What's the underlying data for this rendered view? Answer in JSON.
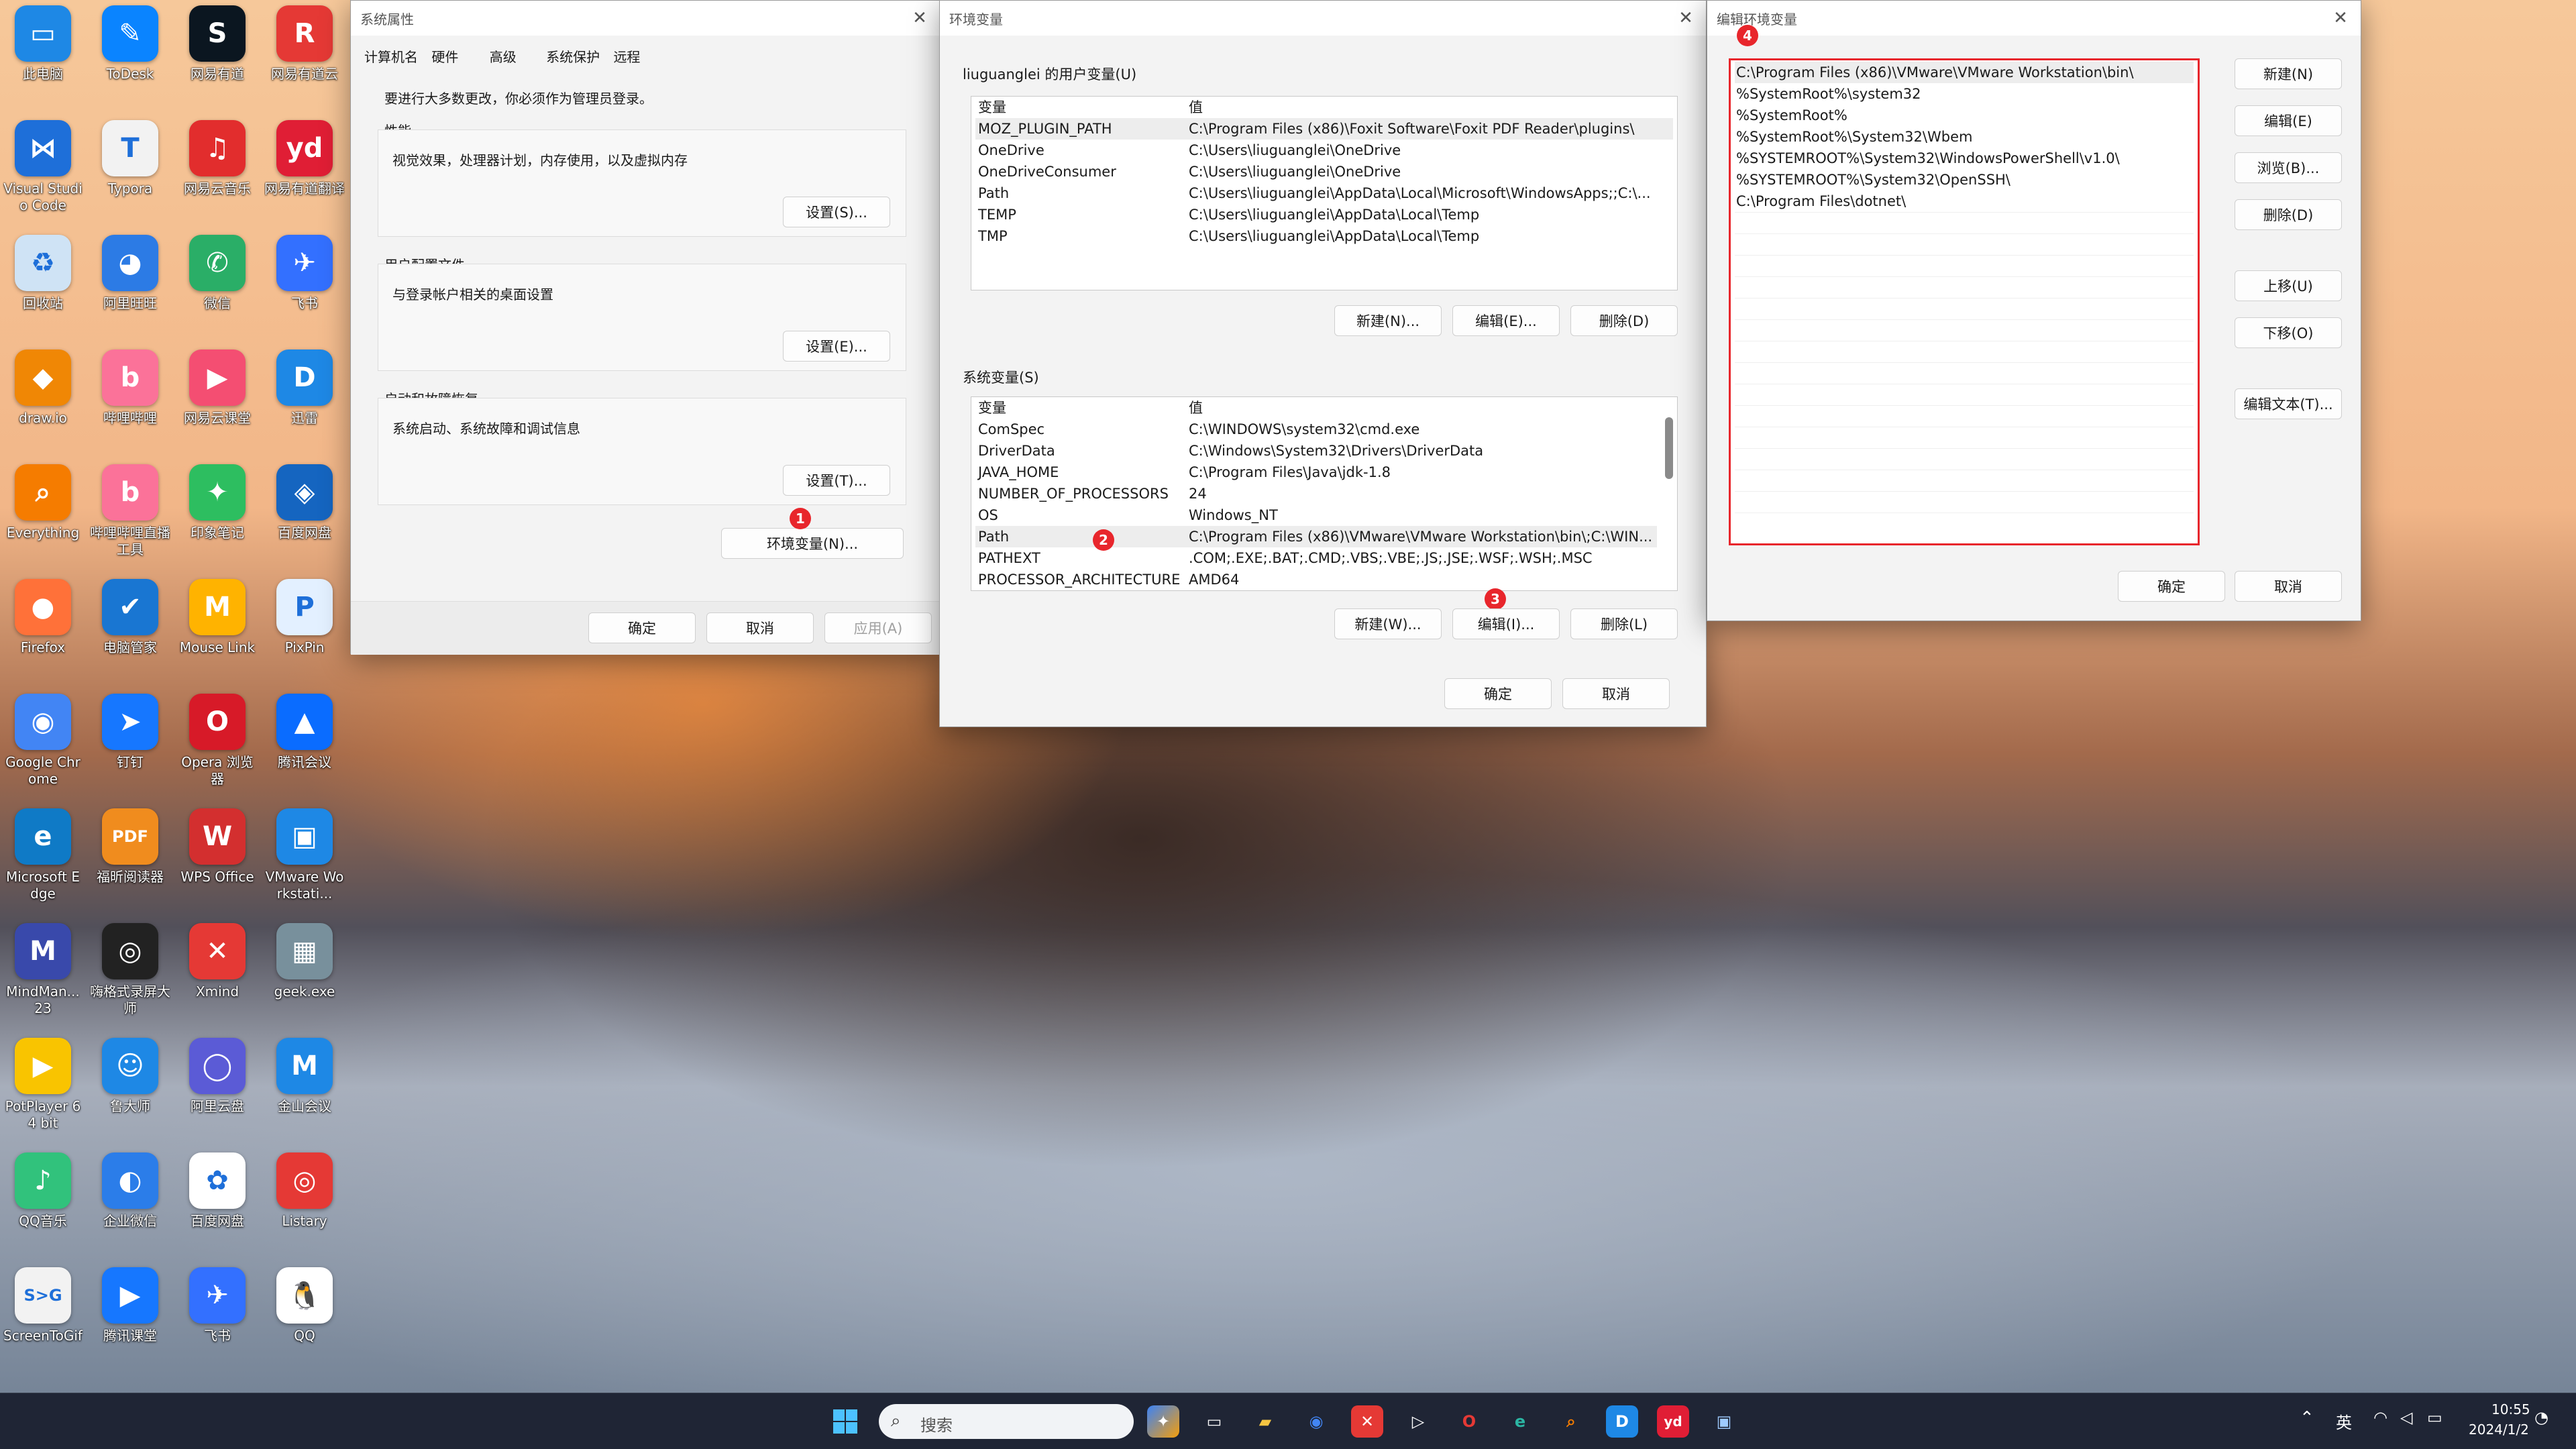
{
  "desktop": {
    "icons": [
      {
        "label": "此电脑",
        "glyph": "▭",
        "color": "#1e88e5"
      },
      {
        "label": "ToDesk",
        "glyph": "✎",
        "color": "#0a84ff"
      },
      {
        "label": "网易有道",
        "glyph": "S",
        "color": "#0b1620"
      },
      {
        "label": "网易有道云",
        "glyph": "R",
        "color": "#e53935"
      },
      {
        "label": "Visual Studio Code",
        "glyph": "⋈",
        "color": "#1e6fd9"
      },
      {
        "label": "Typora",
        "glyph": "T",
        "color": "#f2f2f2"
      },
      {
        "label": "网易云音乐",
        "glyph": "♫",
        "color": "#e22d2d"
      },
      {
        "label": "网易有道翻译",
        "glyph": "yd",
        "color": "#e01e35"
      },
      {
        "label": "回收站",
        "glyph": "♻",
        "color": "#cfe3f5"
      },
      {
        "label": "阿里旺旺",
        "glyph": "◕",
        "color": "#2c7be5"
      },
      {
        "label": "微信",
        "glyph": "✆",
        "color": "#2aae67"
      },
      {
        "label": "飞书",
        "glyph": "✈",
        "color": "#3370ff"
      },
      {
        "label": "draw.io",
        "glyph": "◆",
        "color": "#f08705"
      },
      {
        "label": "哔哩哔哩",
        "glyph": "b",
        "color": "#fb7299"
      },
      {
        "label": "网易云课堂",
        "glyph": "▶",
        "color": "#f44e72"
      },
      {
        "label": "迅雷",
        "glyph": "D",
        "color": "#1e88e5"
      },
      {
        "label": "Everything",
        "glyph": "⌕",
        "color": "#f57c00"
      },
      {
        "label": "哔哩哔哩直播工具",
        "glyph": "b",
        "color": "#fb7299"
      },
      {
        "label": "印象笔记",
        "glyph": "✦",
        "color": "#2dbe60"
      },
      {
        "label": "百度网盘",
        "glyph": "◈",
        "color": "#1565c0"
      },
      {
        "label": "Firefox",
        "glyph": "●",
        "color": "#ff7139"
      },
      {
        "label": "电脑管家",
        "glyph": "✔",
        "color": "#1976d2"
      },
      {
        "label": "Mouse Link",
        "glyph": "M",
        "color": "#ffb300"
      },
      {
        "label": "PixPin",
        "glyph": "P",
        "color": "#e3f0ff"
      },
      {
        "label": "Google Chrome",
        "glyph": "◉",
        "color": "#4285f4"
      },
      {
        "label": "钉钉",
        "glyph": "➤",
        "color": "#1677ff"
      },
      {
        "label": "Opera 浏览器",
        "glyph": "O",
        "color": "#d71a28"
      },
      {
        "label": "腾讯会议",
        "glyph": "▲",
        "color": "#0a6cff"
      },
      {
        "label": "Microsoft Edge",
        "glyph": "e",
        "color": "#0f7ac6"
      },
      {
        "label": "福昕阅读器",
        "glyph": "PDF",
        "color": "#f08c1e"
      },
      {
        "label": "WPS Office",
        "glyph": "W",
        "color": "#d32f2f"
      },
      {
        "label": "VMware Workstati...",
        "glyph": "▣",
        "color": "#1e88e5"
      },
      {
        "label": "MindMan... 23",
        "glyph": "M",
        "color": "#3949ab"
      },
      {
        "label": "嗨格式录屏大师",
        "glyph": "◎",
        "color": "#222"
      },
      {
        "label": "Xmind",
        "glyph": "✕",
        "color": "#e53935"
      },
      {
        "label": "geek.exe",
        "glyph": "▦",
        "color": "#78909c"
      },
      {
        "label": "PotPlayer 64 bit",
        "glyph": "▶",
        "color": "#f9c400"
      },
      {
        "label": "鲁大师",
        "glyph": "☺",
        "color": "#1e88e5"
      },
      {
        "label": "阿里云盘",
        "glyph": "◯",
        "color": "#5b5bd6"
      },
      {
        "label": "金山会议",
        "glyph": "M",
        "color": "#1e88e5"
      },
      {
        "label": "QQ音乐",
        "glyph": "♪",
        "color": "#31c27c"
      },
      {
        "label": "企业微信",
        "glyph": "◐",
        "color": "#2b7de9"
      },
      {
        "label": "百度网盘",
        "glyph": "✿",
        "color": "#ffffff"
      },
      {
        "label": "Listary",
        "glyph": "◎",
        "color": "#e53935"
      },
      {
        "label": "ScreenToGif",
        "glyph": "S>G",
        "color": "#f2f2f2"
      },
      {
        "label": "腾讯课堂",
        "glyph": "▶",
        "color": "#1677ff"
      },
      {
        "label": "飞书",
        "glyph": "✈",
        "color": "#3370ff"
      },
      {
        "label": "QQ",
        "glyph": "🐧",
        "color": "#ffffff"
      }
    ]
  },
  "sysprops": {
    "title": "系统属性",
    "tabs": [
      "计算机名",
      "硬件",
      "高级",
      "系统保护",
      "远程"
    ],
    "admin_note": "要进行大多数更改，你必须作为管理员登录。",
    "perf": {
      "title": "性能",
      "desc": "视觉效果，处理器计划，内存使用，以及虚拟内存",
      "btn": "设置(S)..."
    },
    "profile": {
      "title": "用户配置文件",
      "desc": "与登录帐户相关的桌面设置",
      "btn": "设置(E)..."
    },
    "startup": {
      "title": "启动和故障恢复",
      "desc": "系统启动、系统故障和调试信息",
      "btn": "设置(T)..."
    },
    "env_btn": "环境变量(N)...",
    "ok": "确定",
    "cancel": "取消",
    "apply": "应用(A)"
  },
  "envvars": {
    "title": "环境变量",
    "user_title": "liuguanglei 的用户变量(U)",
    "col_var": "变量",
    "col_val": "值",
    "user_rows": [
      [
        "MOZ_PLUGIN_PATH",
        "C:\\Program Files (x86)\\Foxit Software\\Foxit PDF Reader\\plugins\\"
      ],
      [
        "OneDrive",
        "C:\\Users\\liuguanglei\\OneDrive"
      ],
      [
        "OneDriveConsumer",
        "C:\\Users\\liuguanglei\\OneDrive"
      ],
      [
        "Path",
        "C:\\Users\\liuguanglei\\AppData\\Local\\Microsoft\\WindowsApps;;C:\\..."
      ],
      [
        "TEMP",
        "C:\\Users\\liuguanglei\\AppData\\Local\\Temp"
      ],
      [
        "TMP",
        "C:\\Users\\liuguanglei\\AppData\\Local\\Temp"
      ]
    ],
    "user_btns": [
      "新建(N)...",
      "编辑(E)...",
      "删除(D)"
    ],
    "sys_title": "系统变量(S)",
    "sys_rows": [
      [
        "ComSpec",
        "C:\\WINDOWS\\system32\\cmd.exe"
      ],
      [
        "DriverData",
        "C:\\Windows\\System32\\Drivers\\DriverData"
      ],
      [
        "JAVA_HOME",
        "C:\\Program Files\\Java\\jdk-1.8"
      ],
      [
        "NUMBER_OF_PROCESSORS",
        "24"
      ],
      [
        "OS",
        "Windows_NT"
      ],
      [
        "Path",
        "C:\\Program Files (x86)\\VMware\\VMware Workstation\\bin\\;C:\\WIN..."
      ],
      [
        "PATHEXT",
        ".COM;.EXE;.BAT;.CMD;.VBS;.VBE;.JS;.JSE;.WSF;.WSH;.MSC"
      ],
      [
        "PROCESSOR_ARCHITECTURE",
        "AMD64"
      ]
    ],
    "sys_btns": [
      "新建(W)...",
      "编辑(I)...",
      "删除(L)"
    ],
    "ok": "确定",
    "cancel": "取消"
  },
  "editenv": {
    "title": "编辑环境变量",
    "entries": [
      "C:\\Program Files (x86)\\VMware\\VMware Workstation\\bin\\",
      "%SystemRoot%\\system32",
      "%SystemRoot%",
      "%SystemRoot%\\System32\\Wbem",
      "%SYSTEMROOT%\\System32\\WindowsPowerShell\\v1.0\\",
      "%SYSTEMROOT%\\System32\\OpenSSH\\",
      "C:\\Program Files\\dotnet\\"
    ],
    "btn_new": "新建(N)",
    "btn_edit": "编辑(E)",
    "btn_browse": "浏览(B)...",
    "btn_delete": "删除(D)",
    "btn_up": "上移(U)",
    "btn_down": "下移(O)",
    "btn_edit_text": "编辑文本(T)...",
    "ok": "确定",
    "cancel": "取消"
  },
  "annotations": {
    "b1": "1",
    "b2": "2",
    "b3": "3",
    "b4": "4",
    "highlight_color": "#e8262c"
  },
  "taskbar": {
    "search_placeholder": "搜索",
    "lang": "英",
    "time": "10:55",
    "date": "2024/1/2",
    "apps": [
      "windows-start",
      "copilot",
      "task-view",
      "file-explorer",
      "chrome",
      "xmind",
      "camera",
      "opera",
      "edge",
      "everything",
      "xunlei",
      "youdao",
      "vmware"
    ]
  }
}
